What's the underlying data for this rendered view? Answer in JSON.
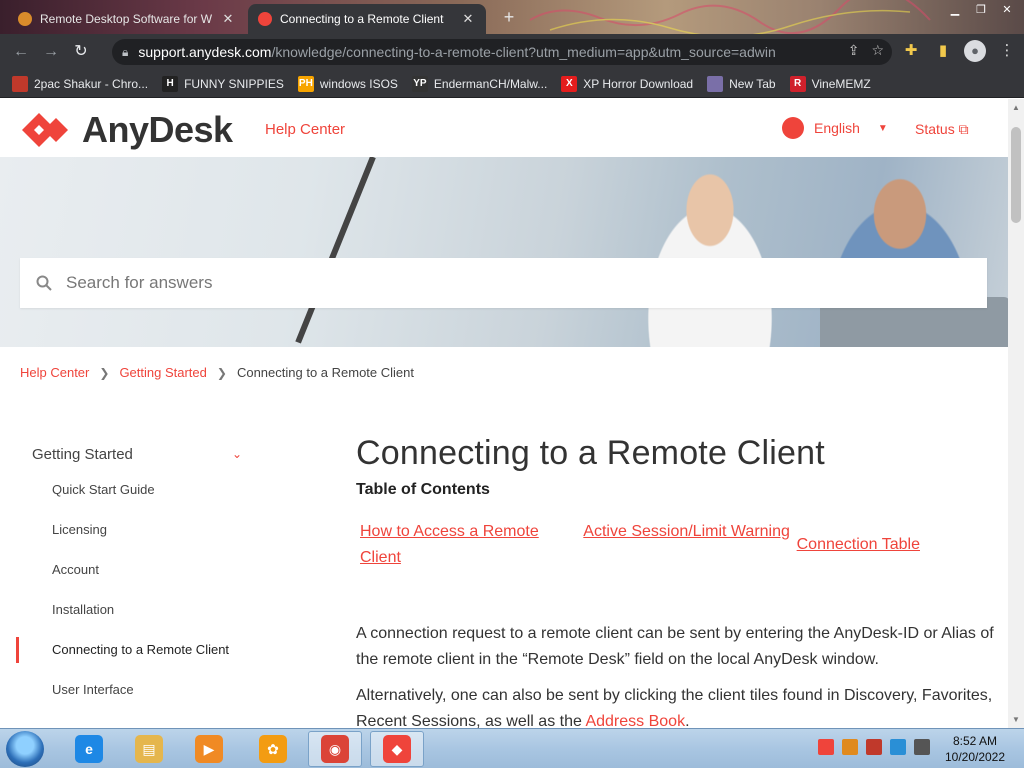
{
  "browser": {
    "tabs": [
      {
        "title": "Remote Desktop Software for W",
        "active": false
      },
      {
        "title": "Connecting to a Remote Client",
        "active": true
      }
    ],
    "new_tab_label": "+",
    "close_glyph": "✕",
    "url_host": "support.anydesk.com",
    "url_path": "/knowledge/connecting-to-a-remote-client?utm_medium=app&utm_source=adwin",
    "bookmarks": [
      {
        "label": "2pac Shakur - Chro...",
        "icon": "bookmark-tupac-icon",
        "color": "#c0392b"
      },
      {
        "label": "FUNNY SNIPPIES",
        "icon": "bookmark-h-icon",
        "color": "#222222",
        "glyph": "H"
      },
      {
        "label": "windows ISOS",
        "icon": "bookmark-ph-icon",
        "color": "#f7a400",
        "glyph": "PH"
      },
      {
        "label": "EndermanCH/Malw...",
        "icon": "bookmark-yp-icon",
        "color": "#333333",
        "glyph": "YP"
      },
      {
        "label": "XP Horror Download",
        "icon": "bookmark-x-icon",
        "color": "#e51d1d",
        "glyph": "X"
      },
      {
        "label": "New Tab",
        "icon": "bookmark-globe-icon",
        "color": "#7a6fa8"
      },
      {
        "label": "VineMEMZ",
        "icon": "bookmark-r-icon",
        "color": "#d0212c",
        "glyph": "R"
      }
    ]
  },
  "site": {
    "brand": "AnyDesk",
    "help_center_link": "Help Center",
    "language": "English",
    "status_link": "Status",
    "accent": "#ef443b",
    "search_placeholder": "Search for answers",
    "breadcrumb": {
      "items": [
        "Help Center",
        "Getting Started"
      ],
      "current": "Connecting to a Remote Client"
    },
    "sidebar": {
      "section": "Getting Started",
      "items": [
        {
          "label": "Quick Start Guide",
          "active": false
        },
        {
          "label": "Licensing",
          "active": false
        },
        {
          "label": "Account",
          "active": false
        },
        {
          "label": "Installation",
          "active": false
        },
        {
          "label": "Connecting to a Remote Client",
          "active": true
        },
        {
          "label": "User Interface",
          "active": false
        }
      ]
    },
    "article": {
      "title": "Connecting to a Remote Client",
      "toc_title": "Table of Contents",
      "toc": [
        "How to Access a Remote Client",
        "Active Session/Limit Warning",
        "Connection Table"
      ],
      "p1": "A connection request to a remote client can be sent by entering the AnyDesk-ID or Alias of the remote client in the “Remote Desk” field on the local AnyDesk window.",
      "p2_text": "Alternatively, one can also be sent by clicking the client tiles found in Discovery, Favorites, Recent Sessions, as well as the ",
      "p2_link": "Address Book",
      "p2_end": "."
    }
  },
  "taskbar": {
    "apps": [
      {
        "name": "internet-explorer",
        "color": "#1e88e5",
        "glyph": "e"
      },
      {
        "name": "file-explorer",
        "color": "#e5b64d",
        "glyph": "▤"
      },
      {
        "name": "media-player",
        "color": "#f08a24",
        "glyph": "▶"
      },
      {
        "name": "uc-browser",
        "color": "#f39c12",
        "glyph": "✿"
      },
      {
        "name": "chrome",
        "color": "#db4437",
        "glyph": "◉"
      },
      {
        "name": "anydesk",
        "color": "#ef443b",
        "glyph": "◆"
      }
    ],
    "time": "8:52 AM",
    "date": "10/20/2022"
  }
}
